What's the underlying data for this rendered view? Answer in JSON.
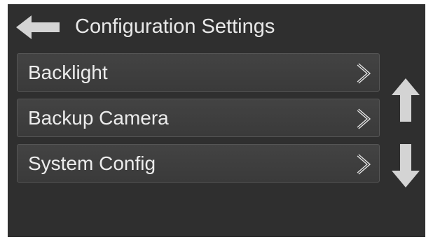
{
  "header": {
    "title": "Configuration Settings",
    "back_icon": "arrow-left-icon"
  },
  "menu": {
    "items": [
      {
        "label": "Backlight",
        "icon": "chevron-right-icon"
      },
      {
        "label": "Backup Camera",
        "icon": "chevron-right-icon"
      },
      {
        "label": "System Config",
        "icon": "chevron-right-icon"
      }
    ]
  },
  "scroll": {
    "up_icon": "arrow-up-icon",
    "down_icon": "arrow-down-icon"
  },
  "colors": {
    "background": "#2f2f2f",
    "text": "#e9e9e9",
    "icon": "#d4d4d4",
    "item_border": "#555555"
  }
}
